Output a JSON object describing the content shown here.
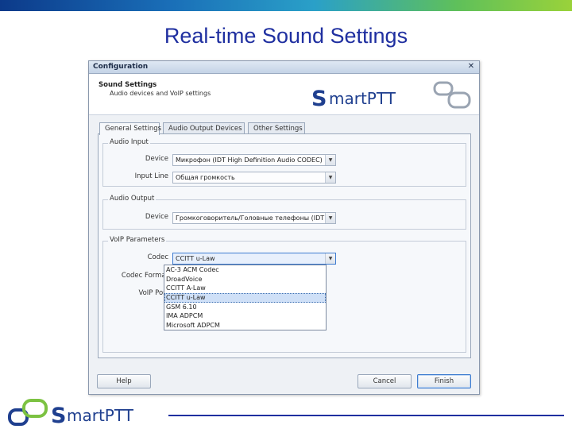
{
  "slide": {
    "title": "Real-time Sound Settings"
  },
  "window": {
    "title": "Configuration",
    "close_glyph": "✕",
    "header": {
      "heading": "Sound Settings",
      "subheading": "Audio devices and VoIP settings"
    },
    "logo_text": "SmartPTT",
    "tabs": [
      {
        "label": "General Settings",
        "active": true
      },
      {
        "label": "Audio Output Devices",
        "active": false
      },
      {
        "label": "Other Settings",
        "active": false
      }
    ],
    "audio_input": {
      "group_label": "Audio Input",
      "device_label": "Device",
      "device_value": "Микрофон (IDT High Definition Audio CODEC)",
      "input_line_label": "Input Line",
      "input_line_value": "Общая громкость"
    },
    "audio_output": {
      "group_label": "Audio Output",
      "device_label": "Device",
      "device_value": "Громкоговоритель/Головные телефоны (IDT Hig"
    },
    "voip": {
      "group_label": "VoIP Parameters",
      "codec_label": "Codec",
      "codec_value": "CCITT u-Law",
      "codec_format_label": "Codec Format",
      "voip_port_label": "VoIP Port",
      "codec_options": [
        "AC-3 ACM Codec",
        "DroadVoice",
        "CCITT A-Law",
        "CCITT u-Law",
        "GSM 6.10",
        "IMA ADPCM",
        "Microsoft ADPCM"
      ],
      "selected_option": "CCITT u-Law"
    },
    "buttons": {
      "help": "Help",
      "cancel": "Cancel",
      "finish": "Finish"
    }
  },
  "footer": {
    "logo_text": "SmartPTT"
  },
  "colors": {
    "title": "#1f2fa0",
    "logo_blue": "#1f3f8f",
    "logo_green": "#7cc242",
    "accent": "#3d7bd0"
  },
  "icons": {
    "close": "close-icon",
    "dropdown": "chevron-down-icon",
    "logo_mark": "smartptt-logo-icon"
  }
}
